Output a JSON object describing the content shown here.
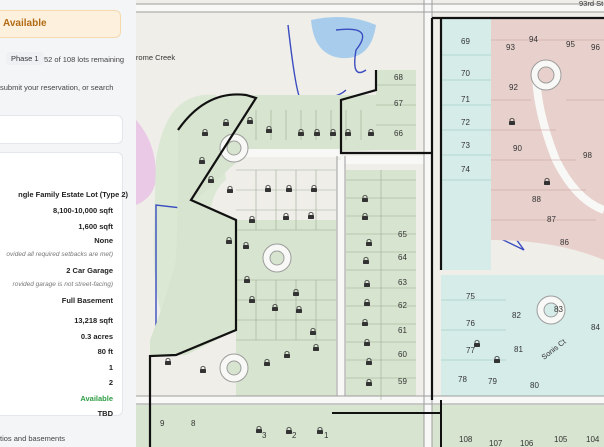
{
  "status": {
    "label": "Available"
  },
  "phase": {
    "label": "Phase 1",
    "count_text": "52 of 108 lots remaining"
  },
  "instructions_text": "submit your reservation, or search",
  "plan": {
    "title": "ngle Family Estate Lot (Type 2)",
    "rows": [
      {
        "value": "8,100-10,000 sqft"
      },
      {
        "value": "1,600 sqft"
      },
      {
        "value": "None"
      },
      {
        "note": "ovided all required setbacks are met)"
      },
      {
        "value": "2 Car Garage"
      },
      {
        "note": "rovided garage is not street-facing)"
      },
      {
        "value": "Full Basement"
      },
      {
        "value": "13,218 sqft"
      },
      {
        "value": "0.3 acres"
      },
      {
        "value": "80 ft"
      },
      {
        "value": "1"
      },
      {
        "value": "2"
      },
      {
        "value": "Available"
      },
      {
        "value": "TBD"
      }
    ]
  },
  "footer_text": "tios and basements",
  "map": {
    "streets": {
      "top_street": "93rd St",
      "cul_de_sac": "Sonis Ct",
      "creek": "Jerome Creek"
    },
    "colors": {
      "available": "#d7e4cf",
      "east_phase": "#d5ece9",
      "northeast_phase": "#e8d1cd",
      "boundary": "#111111",
      "water": "#a8cdec",
      "road_line": "#9d9d9d"
    },
    "lots": {
      "east_column": [
        "69",
        "70",
        "71",
        "72",
        "73",
        "74"
      ],
      "northeast_cluster": [
        "93",
        "94",
        "95",
        "96",
        "92",
        "90",
        "98",
        "88",
        "87",
        "86"
      ],
      "north_row": [
        "68",
        "67",
        "66"
      ],
      "middle_column": [
        "65",
        "64",
        "63",
        "62",
        "61",
        "60",
        "59"
      ],
      "southeast_cluster": [
        "75",
        "76",
        "77",
        "78",
        "79",
        "80",
        "81",
        "82",
        "83",
        "84"
      ],
      "bottom_row": [
        "9",
        "8",
        "3",
        "2",
        "1",
        "108",
        "107",
        "106",
        "105",
        "104"
      ]
    }
  }
}
